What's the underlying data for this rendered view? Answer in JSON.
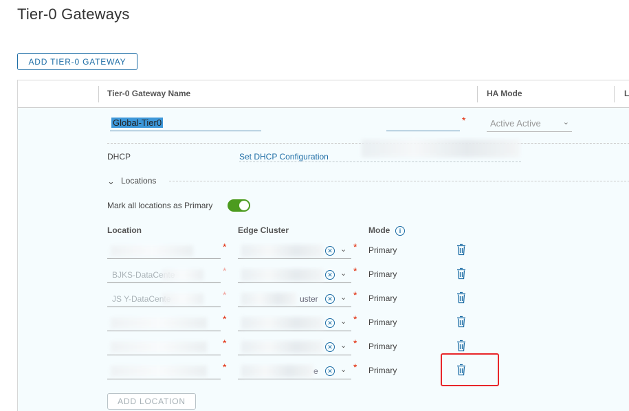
{
  "page": {
    "title": "Tier-0 Gateways"
  },
  "toolbar": {
    "add_gateway_label": "ADD TIER-0 GATEWAY"
  },
  "columns": [
    {
      "label": "Tier-0 Gateway Name"
    },
    {
      "label": "HA Mode"
    },
    {
      "label": "L"
    }
  ],
  "gateway": {
    "name": "Global-Tier0",
    "ha_mode": "Active Active",
    "dhcp_label": "DHCP",
    "dhcp_link": "Set DHCP Configuration",
    "locations_label": "Locations",
    "mark_primary_label": "Mark all locations as Primary",
    "mark_primary_on": true
  },
  "locations_table": {
    "headers": {
      "location": "Location",
      "edge_cluster": "Edge Cluster",
      "mode": "Mode"
    },
    "rows": [
      {
        "location": "",
        "edge_cluster": "",
        "mode": "Primary"
      },
      {
        "location": "BJKS-DataCente",
        "edge_cluster": "",
        "mode": "Primary"
      },
      {
        "location": "JS  Y-DataCente",
        "edge_cluster": "uster",
        "mode": "Primary"
      },
      {
        "location": "",
        "edge_cluster": "",
        "mode": "Primary"
      },
      {
        "location": "",
        "edge_cluster": "",
        "mode": "Primary"
      },
      {
        "location": "",
        "edge_cluster": "e",
        "mode": "Primary"
      }
    ],
    "add_location_label": "ADD LOCATION"
  },
  "colors": {
    "accent": "#1f6ea6",
    "toggle_on": "#4c9b1f",
    "required": "#e12200",
    "highlight": "#e8262a"
  },
  "icons": {
    "delete": "trash-icon",
    "info": "info-icon",
    "clear": "clear-circle-icon",
    "expand": "chevron-down-icon"
  }
}
